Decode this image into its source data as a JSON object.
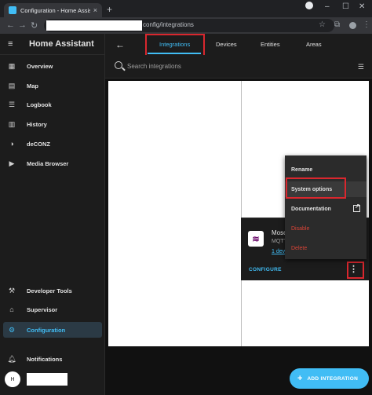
{
  "browser": {
    "tab_title": "Configuration - Home Assistant",
    "tab_close": "×",
    "new_tab": "+",
    "url": "config/integrations",
    "window_controls": [
      "–",
      "☐",
      "✕"
    ]
  },
  "sidebar": {
    "menu_icon": "hamburger-icon",
    "title": "Home Assistant",
    "items": [
      {
        "label": "Overview",
        "icon": "dashboard-icon"
      },
      {
        "label": "Map",
        "icon": "map-icon"
      },
      {
        "label": "Logbook",
        "icon": "logbook-icon"
      },
      {
        "label": "History",
        "icon": "history-icon"
      },
      {
        "label": "deCONZ",
        "icon": "deconz-icon"
      },
      {
        "label": "Media Browser",
        "icon": "media-icon"
      }
    ],
    "bottom_items": [
      {
        "label": "Developer Tools",
        "icon": "hammer-icon"
      },
      {
        "label": "Supervisor",
        "icon": "supervisor-icon"
      },
      {
        "label": "Configuration",
        "icon": "gear-icon",
        "active": true
      },
      {
        "label": "Notifications",
        "icon": "bell-icon"
      }
    ],
    "user_initial": "H"
  },
  "main": {
    "tabs": [
      {
        "label": "Integrations",
        "active": true
      },
      {
        "label": "Devices"
      },
      {
        "label": "Entities"
      },
      {
        "label": "Areas"
      }
    ],
    "search_placeholder": "Search integrations",
    "card": {
      "title": "Mosc",
      "subtitle": "MQTT",
      "link": "1 dev",
      "configure": "CONFIGURE"
    },
    "menu": {
      "items": [
        "Rename",
        "System options",
        "Documentation",
        "Disable",
        "Delete"
      ]
    },
    "fab_label": "ADD INTEGRATION"
  },
  "colors": {
    "accent": "#41bdf5",
    "highlight_box": "#d9272e",
    "danger": "#db4437"
  }
}
